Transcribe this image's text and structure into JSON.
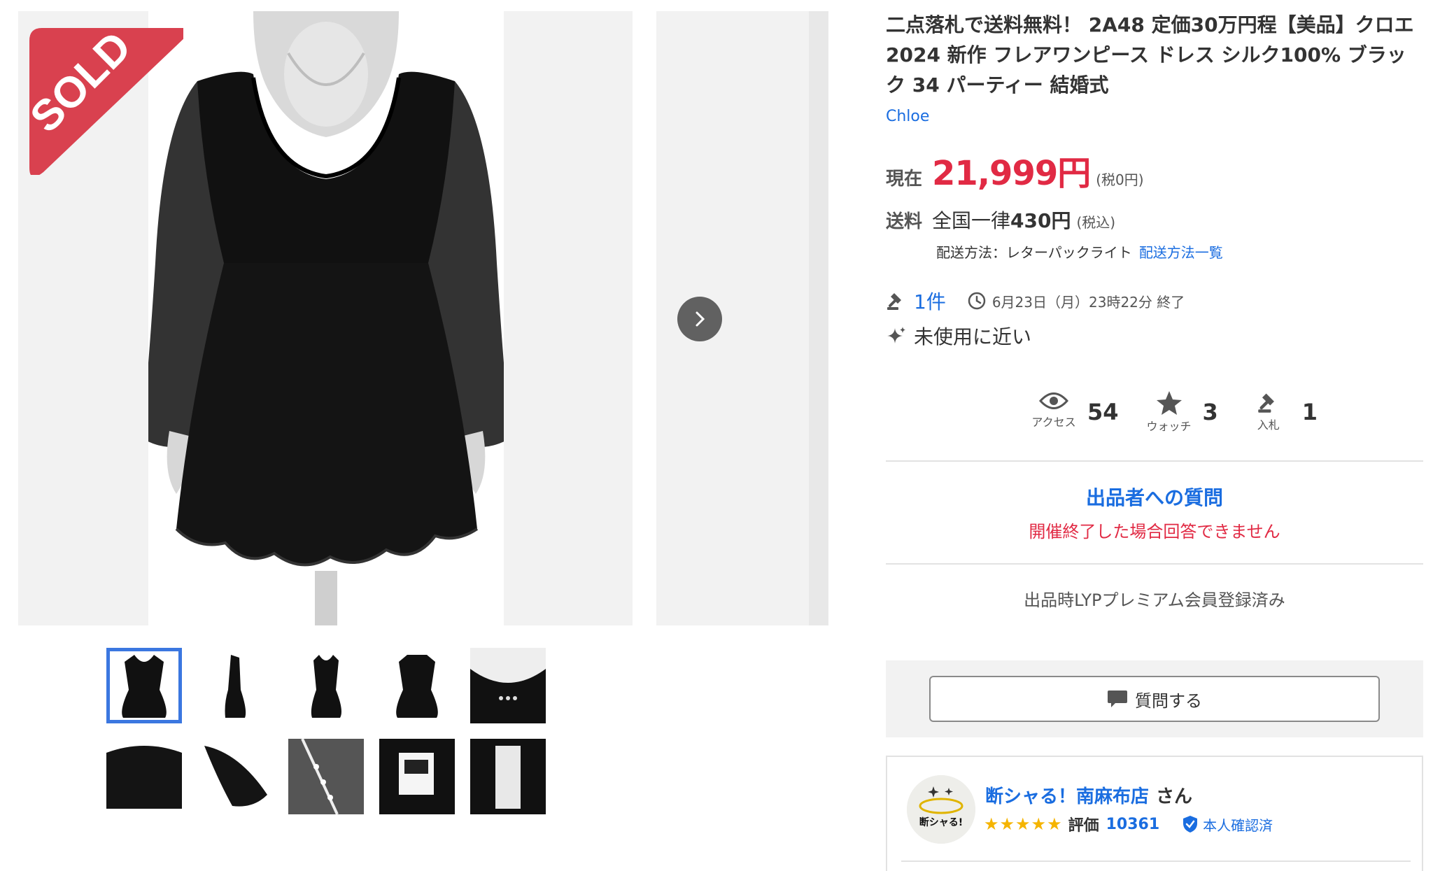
{
  "gallery": {
    "sold_badge": "SOLD",
    "next_arrow": "chevron-right-icon",
    "thumbnails": [
      {
        "name": "thumb-front-full",
        "selected": true
      },
      {
        "name": "thumb-side"
      },
      {
        "name": "thumb-front-angle"
      },
      {
        "name": "thumb-back"
      },
      {
        "name": "thumb-neckline"
      },
      {
        "name": "thumb-waist-detail"
      },
      {
        "name": "thumb-sleeve-detail"
      },
      {
        "name": "thumb-button-detail"
      },
      {
        "name": "thumb-tag"
      },
      {
        "name": "thumb-care-label"
      }
    ]
  },
  "item": {
    "title": "二点落札で送料無料！ 2A48 定価30万円程【美品】クロエ 2024 新作 フレアワンピース ドレス シルク100% ブラック 34 パーティー 結婚式",
    "brand": "Chloe",
    "price_label": "現在",
    "price": "21,999円",
    "price_tax": "(税0円)",
    "shipping_label": "送料",
    "shipping_prefix": "全国一律",
    "shipping_amount": "430円",
    "shipping_tax": "(税込)",
    "shipping_method": "配送方法：レターパックライト",
    "shipping_link": "配送方法一覧",
    "bid_count": "1件",
    "end_time": "6月23日（月）23時22分 終了",
    "condition": "未使用に近い"
  },
  "stats": {
    "access_label": "アクセス",
    "access_value": "54",
    "watch_label": "ウォッチ",
    "watch_value": "3",
    "bid_label": "入札",
    "bid_value": "1"
  },
  "question": {
    "title": "出品者への質問",
    "note": "開催終了した場合回答できません",
    "button": "質問する"
  },
  "premium_note": "出品時LYPプレミアム会員登録済み",
  "seller": {
    "name": "断シャる！南麻布店",
    "suffix": "さん",
    "stars": "★★★★★",
    "rating_label": "評価",
    "rating_count": "10361",
    "verified": "本人確認済",
    "avatar_text": "断シャる!"
  },
  "colors": {
    "accent_blue": "#1a6de0",
    "price_red": "#e12a44",
    "sold_red": "#d9414f",
    "star_yellow": "#f5b400"
  }
}
